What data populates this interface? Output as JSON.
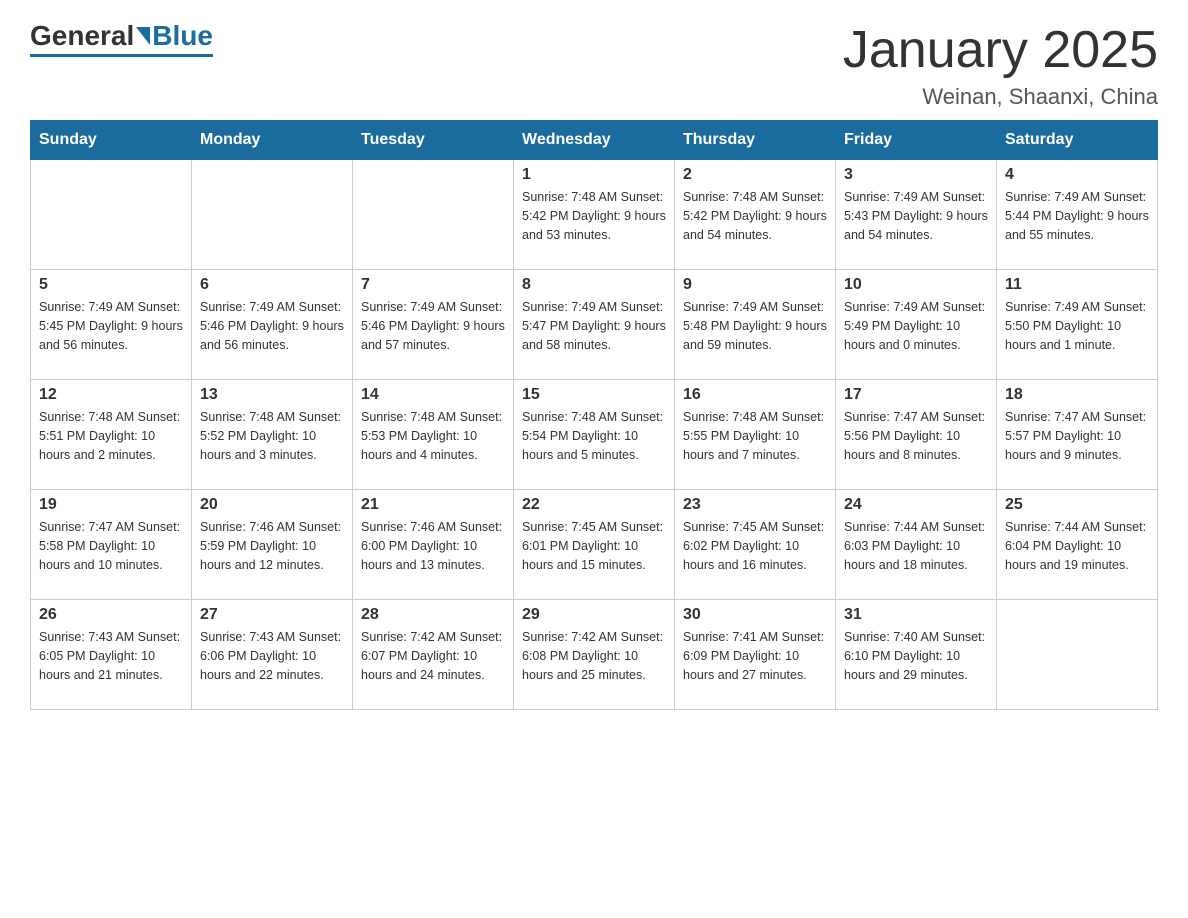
{
  "header": {
    "logo_general": "General",
    "logo_blue": "Blue",
    "title": "January 2025",
    "subtitle": "Weinan, Shaanxi, China"
  },
  "days_of_week": [
    "Sunday",
    "Monday",
    "Tuesday",
    "Wednesday",
    "Thursday",
    "Friday",
    "Saturday"
  ],
  "weeks": [
    [
      {
        "day": "",
        "info": ""
      },
      {
        "day": "",
        "info": ""
      },
      {
        "day": "",
        "info": ""
      },
      {
        "day": "1",
        "info": "Sunrise: 7:48 AM\nSunset: 5:42 PM\nDaylight: 9 hours\nand 53 minutes."
      },
      {
        "day": "2",
        "info": "Sunrise: 7:48 AM\nSunset: 5:42 PM\nDaylight: 9 hours\nand 54 minutes."
      },
      {
        "day": "3",
        "info": "Sunrise: 7:49 AM\nSunset: 5:43 PM\nDaylight: 9 hours\nand 54 minutes."
      },
      {
        "day": "4",
        "info": "Sunrise: 7:49 AM\nSunset: 5:44 PM\nDaylight: 9 hours\nand 55 minutes."
      }
    ],
    [
      {
        "day": "5",
        "info": "Sunrise: 7:49 AM\nSunset: 5:45 PM\nDaylight: 9 hours\nand 56 minutes."
      },
      {
        "day": "6",
        "info": "Sunrise: 7:49 AM\nSunset: 5:46 PM\nDaylight: 9 hours\nand 56 minutes."
      },
      {
        "day": "7",
        "info": "Sunrise: 7:49 AM\nSunset: 5:46 PM\nDaylight: 9 hours\nand 57 minutes."
      },
      {
        "day": "8",
        "info": "Sunrise: 7:49 AM\nSunset: 5:47 PM\nDaylight: 9 hours\nand 58 minutes."
      },
      {
        "day": "9",
        "info": "Sunrise: 7:49 AM\nSunset: 5:48 PM\nDaylight: 9 hours\nand 59 minutes."
      },
      {
        "day": "10",
        "info": "Sunrise: 7:49 AM\nSunset: 5:49 PM\nDaylight: 10 hours\nand 0 minutes."
      },
      {
        "day": "11",
        "info": "Sunrise: 7:49 AM\nSunset: 5:50 PM\nDaylight: 10 hours\nand 1 minute."
      }
    ],
    [
      {
        "day": "12",
        "info": "Sunrise: 7:48 AM\nSunset: 5:51 PM\nDaylight: 10 hours\nand 2 minutes."
      },
      {
        "day": "13",
        "info": "Sunrise: 7:48 AM\nSunset: 5:52 PM\nDaylight: 10 hours\nand 3 minutes."
      },
      {
        "day": "14",
        "info": "Sunrise: 7:48 AM\nSunset: 5:53 PM\nDaylight: 10 hours\nand 4 minutes."
      },
      {
        "day": "15",
        "info": "Sunrise: 7:48 AM\nSunset: 5:54 PM\nDaylight: 10 hours\nand 5 minutes."
      },
      {
        "day": "16",
        "info": "Sunrise: 7:48 AM\nSunset: 5:55 PM\nDaylight: 10 hours\nand 7 minutes."
      },
      {
        "day": "17",
        "info": "Sunrise: 7:47 AM\nSunset: 5:56 PM\nDaylight: 10 hours\nand 8 minutes."
      },
      {
        "day": "18",
        "info": "Sunrise: 7:47 AM\nSunset: 5:57 PM\nDaylight: 10 hours\nand 9 minutes."
      }
    ],
    [
      {
        "day": "19",
        "info": "Sunrise: 7:47 AM\nSunset: 5:58 PM\nDaylight: 10 hours\nand 10 minutes."
      },
      {
        "day": "20",
        "info": "Sunrise: 7:46 AM\nSunset: 5:59 PM\nDaylight: 10 hours\nand 12 minutes."
      },
      {
        "day": "21",
        "info": "Sunrise: 7:46 AM\nSunset: 6:00 PM\nDaylight: 10 hours\nand 13 minutes."
      },
      {
        "day": "22",
        "info": "Sunrise: 7:45 AM\nSunset: 6:01 PM\nDaylight: 10 hours\nand 15 minutes."
      },
      {
        "day": "23",
        "info": "Sunrise: 7:45 AM\nSunset: 6:02 PM\nDaylight: 10 hours\nand 16 minutes."
      },
      {
        "day": "24",
        "info": "Sunrise: 7:44 AM\nSunset: 6:03 PM\nDaylight: 10 hours\nand 18 minutes."
      },
      {
        "day": "25",
        "info": "Sunrise: 7:44 AM\nSunset: 6:04 PM\nDaylight: 10 hours\nand 19 minutes."
      }
    ],
    [
      {
        "day": "26",
        "info": "Sunrise: 7:43 AM\nSunset: 6:05 PM\nDaylight: 10 hours\nand 21 minutes."
      },
      {
        "day": "27",
        "info": "Sunrise: 7:43 AM\nSunset: 6:06 PM\nDaylight: 10 hours\nand 22 minutes."
      },
      {
        "day": "28",
        "info": "Sunrise: 7:42 AM\nSunset: 6:07 PM\nDaylight: 10 hours\nand 24 minutes."
      },
      {
        "day": "29",
        "info": "Sunrise: 7:42 AM\nSunset: 6:08 PM\nDaylight: 10 hours\nand 25 minutes."
      },
      {
        "day": "30",
        "info": "Sunrise: 7:41 AM\nSunset: 6:09 PM\nDaylight: 10 hours\nand 27 minutes."
      },
      {
        "day": "31",
        "info": "Sunrise: 7:40 AM\nSunset: 6:10 PM\nDaylight: 10 hours\nand 29 minutes."
      },
      {
        "day": "",
        "info": ""
      }
    ]
  ]
}
